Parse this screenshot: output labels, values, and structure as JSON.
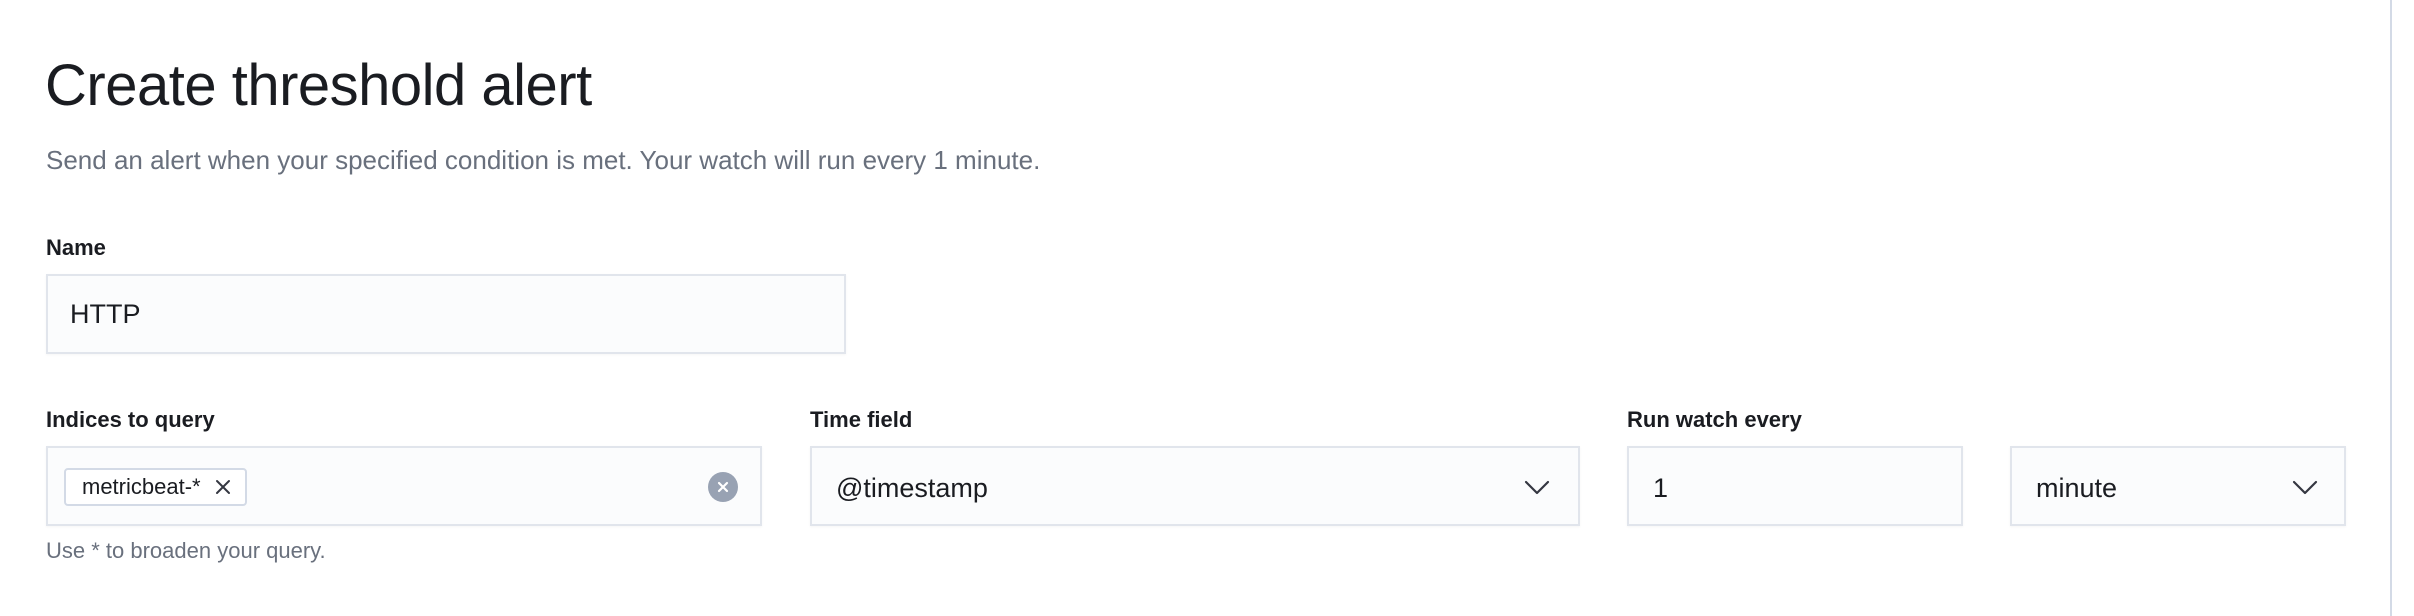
{
  "header": {
    "title": "Create threshold alert",
    "subtitle": "Send an alert when your specified condition is met. Your watch will run every 1 minute."
  },
  "name_field": {
    "label": "Name",
    "value": "HTTP"
  },
  "indices_field": {
    "label": "Indices to query",
    "selected_index": "metricbeat-*",
    "remove_icon": "cross-icon",
    "clear_icon": "clear-circle-icon",
    "help_text": "Use * to broaden your query."
  },
  "time_field": {
    "label": "Time field",
    "selected": "@timestamp",
    "icon": "chevron-down-icon"
  },
  "run_watch": {
    "label": "Run watch every",
    "interval_value": "1",
    "unit_selected": "minute",
    "icon": "chevron-down-icon"
  },
  "colors": {
    "title_text": "#1a1c21",
    "secondary_text": "#69707d",
    "field_background": "#fbfcfd",
    "field_border": "#e1e5ec",
    "clear_button": "#98a2b3"
  }
}
